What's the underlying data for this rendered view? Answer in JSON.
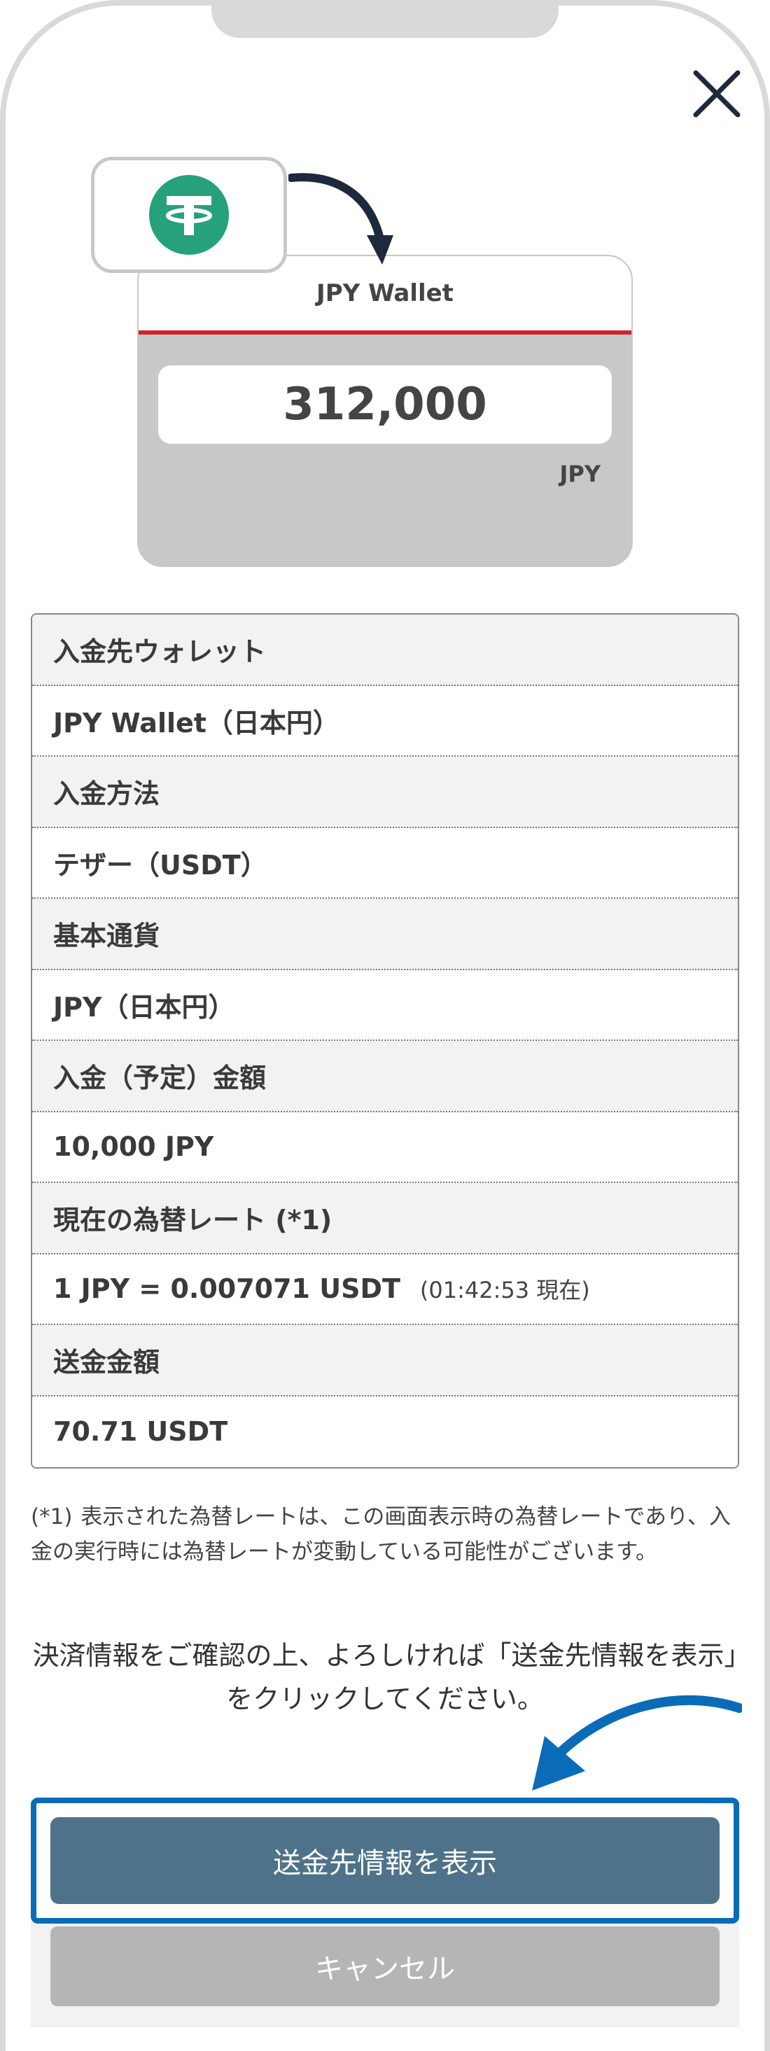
{
  "close_icon": "close-icon",
  "illustration": {
    "coin_icon": "tether-icon",
    "wallet_name": "JPY Wallet",
    "balance": "312,000",
    "currency": "JPY"
  },
  "details": {
    "rows": [
      {
        "label": "入金先ウォレット",
        "value": "JPY Wallet（日本円）"
      },
      {
        "label": "入金方法",
        "value": "テザー（USDT）"
      },
      {
        "label": "基本通貨",
        "value": "JPY（日本円）"
      },
      {
        "label": "入金（予定）金額",
        "value": "10,000 JPY"
      },
      {
        "label": "現在の為替レート (*1)",
        "value": "1 JPY = 0.007071 USDT",
        "sub": "(01:42:53 現在)"
      },
      {
        "label": "送金金額",
        "value": "70.71 USDT"
      }
    ]
  },
  "note": {
    "mark": "(*1)",
    "text": "表示された為替レートは、この画面表示時の為替レートであり、入金の実行時には為替レートが変動している可能性がございます。"
  },
  "confirm_message": "決済情報をご確認の上、よろしければ「送金先情報を表示」をクリックしてください。",
  "buttons": {
    "primary": "送金先情報を表示",
    "cancel": "キャンセル"
  },
  "colors": {
    "accent_red": "#d1232a",
    "tether_green": "#26a17b",
    "primary_button": "#4e7289",
    "highlight_blue": "#0a6bb8"
  }
}
